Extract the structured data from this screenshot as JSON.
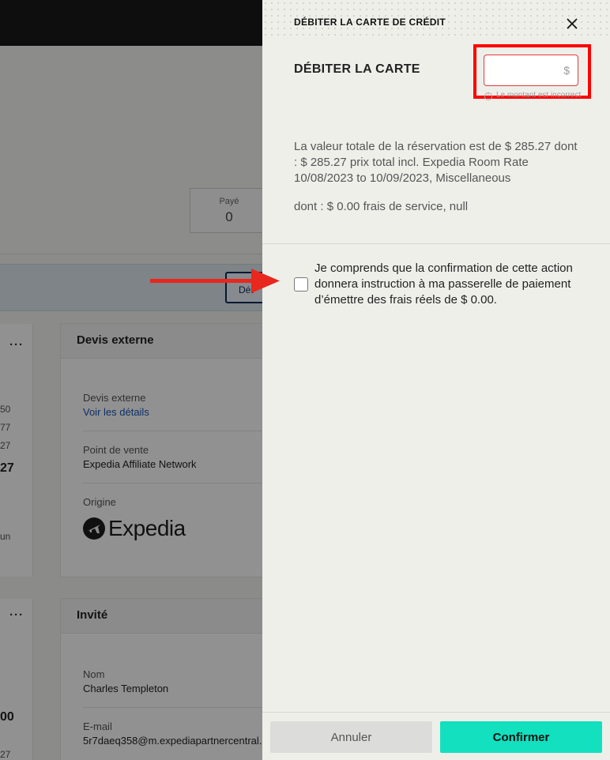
{
  "background": {
    "paid": {
      "label": "Payé",
      "value": "0"
    },
    "band_button_label": "Dét",
    "left_column_fragments": [
      "50",
      "77",
      "27",
      "27",
      "un"
    ],
    "left_column2_fragments": [
      "00",
      "27"
    ],
    "more_icon": "ellipsis-icon",
    "external_quote_card": {
      "title": "Devis externe",
      "fields": [
        {
          "label": "Devis externe",
          "link": "Voir les détails"
        },
        {
          "label": "Point de vente",
          "value": "Expedia Affiliate Network"
        },
        {
          "label": "Origine",
          "logo_text": "Expedia"
        }
      ]
    },
    "guest_card": {
      "title": "Invité",
      "fields": [
        {
          "label": "Nom",
          "value": "Charles Templeton"
        },
        {
          "label": "E-mail",
          "value": "5r7daeq358@m.expediapartnercentral."
        }
      ]
    }
  },
  "panel": {
    "title": "DÉBITER LA CARTE DE CRÉDIT",
    "close_icon": "close-icon",
    "charge_label": "DÉBITER LA CARTE",
    "amount": {
      "value": "",
      "placeholder": "",
      "currency": "$"
    },
    "error_text": "Le montant est incorrect",
    "info_paragraphs": [
      "La valeur totale de la réservation est de $ 285.27 dont : $ 285.27 prix total incl. Expedia Room Rate 10/08/2023 to 10/09/2023, Miscellaneous",
      "dont : $ 0.00 frais de service, null"
    ],
    "confirmation_text": "Je comprends que la confirmation de cette action donnera instruction à ma passerelle de paiement d’émettre des frais réels de $ 0.00.",
    "confirmation_checked": false,
    "buttons": {
      "cancel": "Annuler",
      "confirm": "Confirmer"
    }
  },
  "colors": {
    "highlight_box": "#ff0000",
    "annotation_arrow": "#e8271f",
    "confirm_button": "#12e0be",
    "overlay": "rgba(0,0,0,0.43)"
  }
}
